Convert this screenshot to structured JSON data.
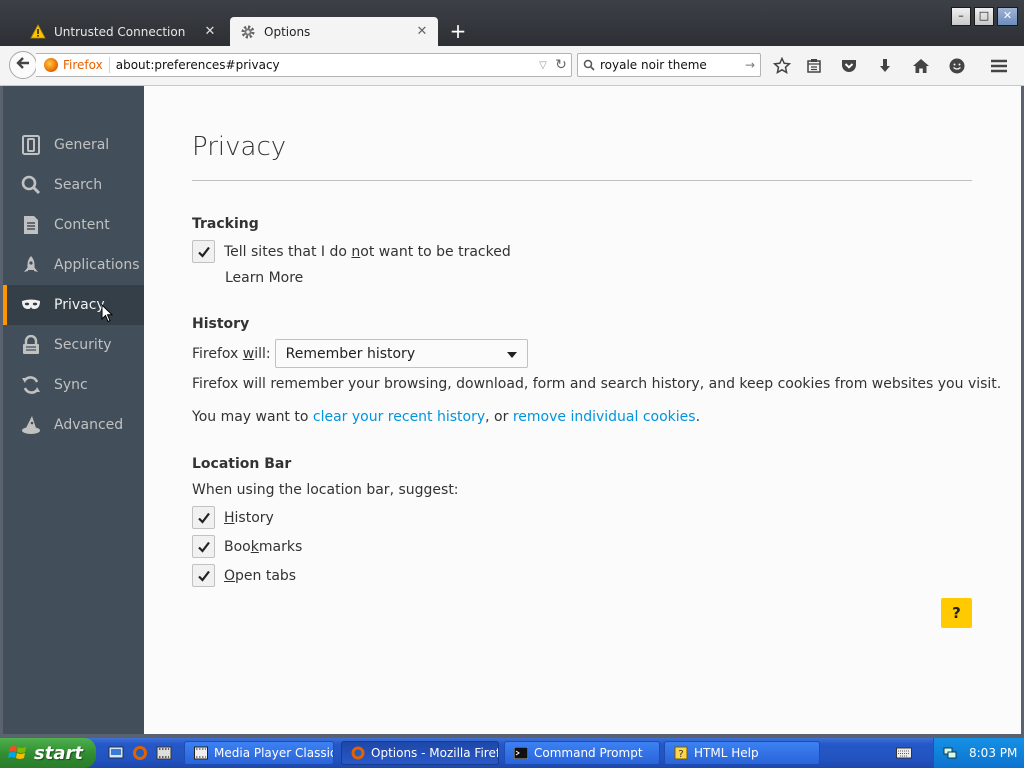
{
  "tabs": [
    {
      "title": "Untrusted Connection",
      "icon": "warning-icon",
      "close": "✕"
    },
    {
      "title": "Options",
      "icon": "gear-icon",
      "close": "✕"
    }
  ],
  "new_tab": "+",
  "window_controls": {
    "minimize": "–",
    "maximize": "□",
    "close": "✕"
  },
  "navbar": {
    "identity_label": "Firefox",
    "url": "about:preferences#privacy",
    "search_value": "royale noir theme"
  },
  "sidebar": {
    "items": [
      {
        "label": "General",
        "icon": "general-icon"
      },
      {
        "label": "Search",
        "icon": "search-icon"
      },
      {
        "label": "Content",
        "icon": "content-icon"
      },
      {
        "label": "Applications",
        "icon": "applications-icon"
      },
      {
        "label": "Privacy",
        "icon": "privacy-mask-icon",
        "selected": true
      },
      {
        "label": "Security",
        "icon": "security-lock-icon"
      },
      {
        "label": "Sync",
        "icon": "sync-icon"
      },
      {
        "label": "Advanced",
        "icon": "advanced-wizard-icon"
      }
    ]
  },
  "main": {
    "title": "Privacy",
    "tracking": {
      "heading": "Tracking",
      "dnt_label_pre": "Tell sites that I do ",
      "dnt_label_u": "n",
      "dnt_label_post": "ot want to be tracked",
      "dnt_checked": true,
      "learn_more": "Learn More"
    },
    "history": {
      "heading": "History",
      "firefox_will_pre": "Firefox ",
      "firefox_will_u": "w",
      "firefox_will_post": "ill:",
      "select_value": "Remember history",
      "description": "Firefox will remember your browsing, download, form and search history, and keep cookies from websites you visit.",
      "line2_pre": "You may want to ",
      "clear_link": "clear your recent history",
      "line2_mid": ", or ",
      "cookies_link": "remove individual cookies",
      "line2_post": "."
    },
    "location_bar": {
      "heading": "Location Bar",
      "subtext": "When using the location bar, suggest:",
      "options": [
        {
          "pre": "",
          "u": "H",
          "post": "istory",
          "checked": true
        },
        {
          "pre": "Boo",
          "u": "k",
          "post": "marks",
          "checked": true
        },
        {
          "pre": "",
          "u": "O",
          "post": "pen tabs",
          "checked": true
        }
      ]
    },
    "help_label": "?"
  },
  "taskbar": {
    "start_label": "start",
    "tasks": [
      {
        "label": "Media Player Classic ...",
        "active": false
      },
      {
        "label": "Options - Mozilla Firefox",
        "active": true
      },
      {
        "label": "Command Prompt",
        "active": false
      },
      {
        "label": "HTML Help",
        "active": false
      }
    ],
    "clock": "8:03 PM"
  },
  "colors": {
    "accent_link": "#0095dd",
    "sidebar_bg": "#424f5a",
    "sidebar_selected_marker": "#ff9500",
    "help_button": "#ffcb00"
  }
}
